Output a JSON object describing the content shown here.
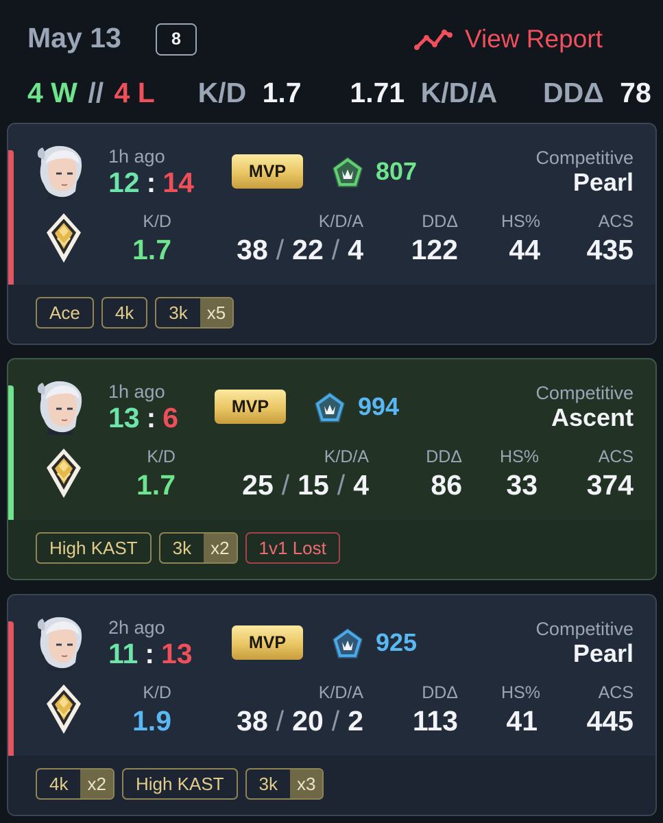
{
  "header": {
    "date": "May 13",
    "match_count": "8",
    "view_report_label": "View Report",
    "summary": {
      "wins": "4 W",
      "separator": "//",
      "losses": "4 L",
      "kd_label": "K/D",
      "kd_value": "1.7",
      "kda_value": "1.71",
      "kda_label": "K/D/A",
      "dda_label": "DDΔ",
      "dda_value": "78"
    }
  },
  "stat_labels": {
    "kd": "K/D",
    "kda": "K/D/A",
    "dda": "DDΔ",
    "hs": "HS%",
    "acs": "ACS"
  },
  "colors": {
    "win": "#72e28f",
    "loss": "#e45562",
    "accent_red": "#f0505c",
    "blue": "#59b7f2"
  },
  "matches": [
    {
      "result": "loss",
      "time_ago": "1h ago",
      "score_team": "12",
      "score_enemy": "14",
      "score_separator": ":",
      "mvp_label": "MVP",
      "rr_icon": "green-rank-badge-icon",
      "rr_value": "807",
      "mode": "Competitive",
      "map": "Pearl",
      "kd": "1.7",
      "kills": "38",
      "deaths": "22",
      "assists": "4",
      "dda": "122",
      "hs": "44",
      "acs": "435",
      "tags": [
        {
          "label": "Ace",
          "mult": ""
        },
        {
          "label": "4k",
          "mult": ""
        },
        {
          "label": "3k",
          "mult": "x5"
        }
      ]
    },
    {
      "result": "win",
      "time_ago": "1h ago",
      "score_team": "13",
      "score_enemy": "6",
      "score_separator": ":",
      "mvp_label": "MVP",
      "rr_icon": "blue-rank-badge-icon",
      "rr_value": "994",
      "mode": "Competitive",
      "map": "Ascent",
      "kd": "1.7",
      "kills": "25",
      "deaths": "15",
      "assists": "4",
      "dda": "86",
      "hs": "33",
      "acs": "374",
      "tags": [
        {
          "label": "High KAST",
          "mult": ""
        },
        {
          "label": "3k",
          "mult": "x2"
        },
        {
          "label": "1v1 Lost",
          "mult": ""
        }
      ]
    },
    {
      "result": "loss",
      "time_ago": "2h ago",
      "score_team": "11",
      "score_enemy": "13",
      "score_separator": ":",
      "mvp_label": "MVP",
      "rr_icon": "blue-rank-badge-icon",
      "rr_value": "925",
      "mode": "Competitive",
      "map": "Pearl",
      "kd": "1.9",
      "kills": "38",
      "deaths": "20",
      "assists": "2",
      "dda": "113",
      "hs": "41",
      "acs": "445",
      "tags": [
        {
          "label": "4k",
          "mult": "x2"
        },
        {
          "label": "High KAST",
          "mult": ""
        },
        {
          "label": "3k",
          "mult": "x3"
        }
      ]
    }
  ]
}
